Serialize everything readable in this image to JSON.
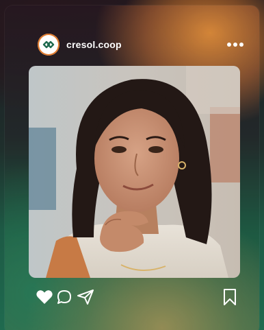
{
  "post": {
    "username": "cresol.coop",
    "avatar_icon": "cresol-logo-icon",
    "more_icon": "more-options-icon",
    "photo_icon": "post-photo",
    "actions": {
      "like_icon": "heart-icon",
      "comment_icon": "comment-icon",
      "share_icon": "paper-plane-icon",
      "save_icon": "bookmark-icon"
    },
    "liked": true
  },
  "colors": {
    "brand_orange": "#e07a2c",
    "brand_green": "#1f6a4f",
    "icon_white": "#ffffff"
  }
}
